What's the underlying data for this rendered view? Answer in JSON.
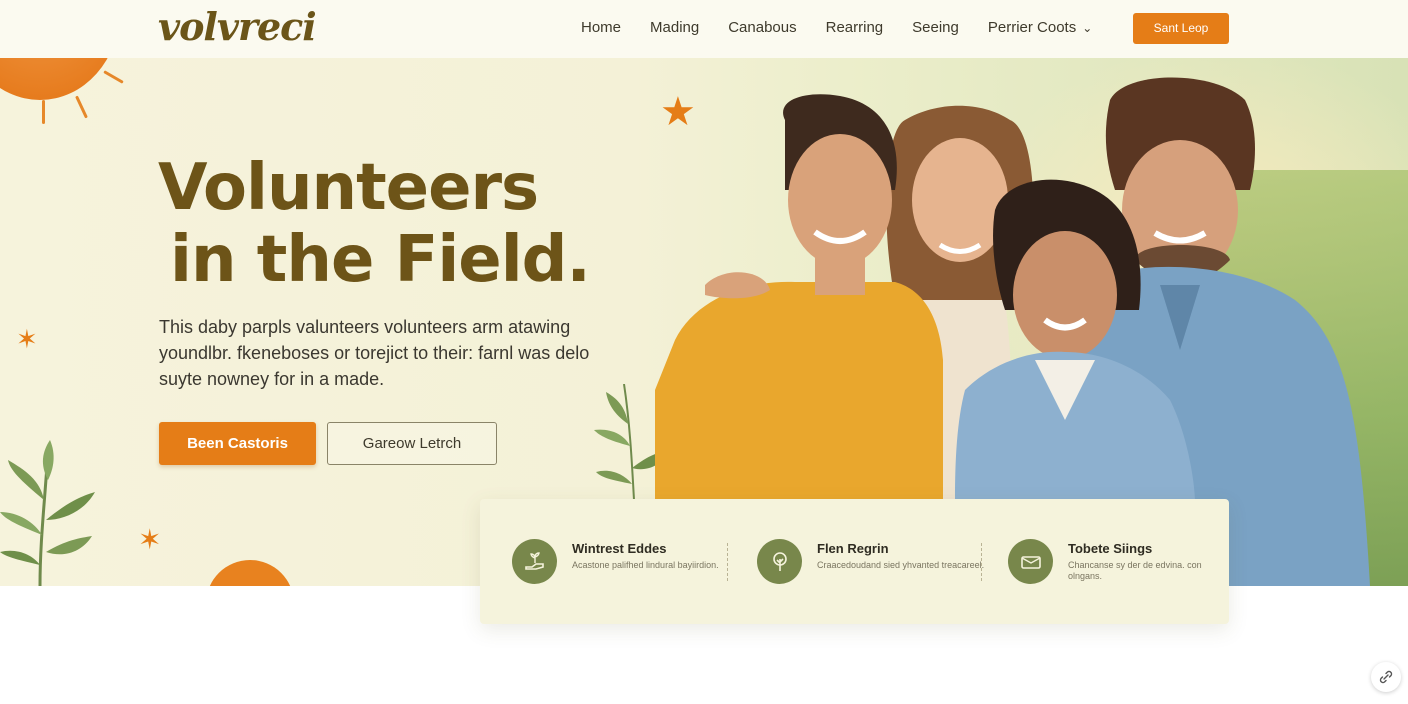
{
  "brand": {
    "logo_text": "volvreci"
  },
  "nav": {
    "items": [
      {
        "label": "Home"
      },
      {
        "label": "Mading"
      },
      {
        "label": "Canabous"
      },
      {
        "label": "Rearring"
      },
      {
        "label": "Seeing"
      },
      {
        "label": "Perrier Coots",
        "has_dropdown": true
      }
    ],
    "cta_label": "Sant Leop"
  },
  "hero": {
    "headline_line1": "Volunteers",
    "headline_line2": "in the Field.",
    "lede": "This daby parpls valunteers volunteers arm atawing youndlbr. fkeneboses or torejict to their: farnl was delo suyte nowney for in a made.",
    "primary_button": "Been Castoris",
    "secondary_button": "Gareow Letrch"
  },
  "features": [
    {
      "title": "Wintrest Eddes",
      "desc": "Acastone palifhed lindural bayiirdion.",
      "icon": "hand-plant-icon"
    },
    {
      "title": "Flen Regrin",
      "desc": "Craacedoudand sied yhvanted treacareel.",
      "icon": "tree-icon"
    },
    {
      "title": "Tobete Siings",
      "desc": "Chancanse sy der de edvina. con olngans.",
      "icon": "card-icon"
    }
  ],
  "colors": {
    "accent": "#e57d17",
    "brand_brown": "#6d5418",
    "olive": "#78874b",
    "hero_bg": "#f5f2da"
  }
}
